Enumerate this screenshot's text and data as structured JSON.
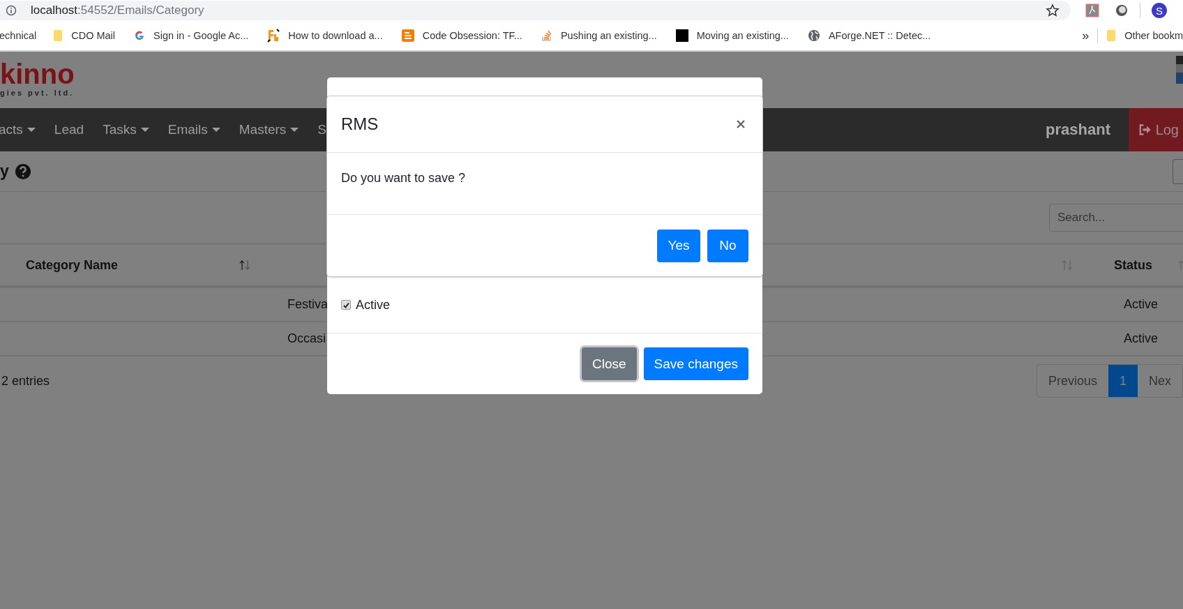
{
  "browser": {
    "address": {
      "host": "localhost",
      "path": ":54552/Emails/Category"
    },
    "profile_initial": "S",
    "bookmarks": [
      {
        "label": "echnical",
        "kind": "none"
      },
      {
        "label": "CDO Mail",
        "kind": "folder"
      },
      {
        "label": "Sign in - Google Ac...",
        "kind": "google"
      },
      {
        "label": "How to download a...",
        "kind": "fb"
      },
      {
        "label": "Code Obsession: TF...",
        "kind": "blogger"
      },
      {
        "label": "Pushing an existing...",
        "kind": "stack"
      },
      {
        "label": "Moving an existing...",
        "kind": "square"
      },
      {
        "label": "AForge.NET :: Detec...",
        "kind": "globe"
      }
    ],
    "overflow": "»",
    "other_bookmarks": "Other bookm"
  },
  "app": {
    "logo": {
      "name": "kinno",
      "tagline": "gies pvt. ltd."
    },
    "nav": [
      {
        "label": "acts",
        "dropdown": true
      },
      {
        "label": "Lead",
        "dropdown": false
      },
      {
        "label": "Tasks",
        "dropdown": true
      },
      {
        "label": "Emails",
        "dropdown": true
      },
      {
        "label": "Masters",
        "dropdown": true
      },
      {
        "label": "S",
        "dropdown": false
      }
    ],
    "user": "prashant",
    "logout": "Log"
  },
  "page": {
    "title": "y",
    "search": {
      "placeholder": "Search..."
    },
    "table": {
      "columns": [
        {
          "label": "Category Name"
        },
        {
          "label": "Status"
        }
      ],
      "rows": [
        {
          "name": "Festiva",
          "status": "Active"
        },
        {
          "name": "Occasi",
          "status": "Active"
        }
      ]
    },
    "info": "2 entries",
    "pagination": [
      {
        "label": "Previous",
        "selected": false
      },
      {
        "label": "1",
        "selected": true
      },
      {
        "label": "Nex",
        "selected": false
      }
    ]
  },
  "modal": {
    "confirm": {
      "title": "RMS",
      "message": "Do you want to save ?",
      "buttons": [
        "Yes",
        "No"
      ]
    },
    "active_checkbox": {
      "label": "Active",
      "checked": true
    },
    "buttons": [
      {
        "label": "Close",
        "kind": "secondary",
        "focused": true
      },
      {
        "label": "Save changes",
        "kind": "primary",
        "focused": false
      }
    ]
  }
}
